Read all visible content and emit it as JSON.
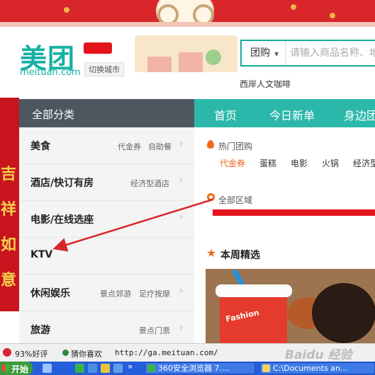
{
  "header": {
    "logo_cn": "美团",
    "logo_en": "meituan.com",
    "city_switch": "切换城市",
    "search_type": "团购",
    "search_placeholder": "请输入商品名称、地",
    "shop_name": "西岸人文咖啡"
  },
  "categories": {
    "title": "全部分类",
    "items": [
      {
        "label": "美食",
        "subs": [
          "代金券",
          "自助餐"
        ]
      },
      {
        "label": "酒店/快订有房",
        "subs": [
          "经济型酒店"
        ]
      },
      {
        "label": "电影/在线选座",
        "subs": []
      },
      {
        "label": "KTV",
        "subs": []
      },
      {
        "label": "休闲娱乐",
        "subs": [
          "景点郊游",
          "足疗按摩"
        ]
      },
      {
        "label": "旅游",
        "subs": [
          "景点门票"
        ]
      }
    ]
  },
  "nav": {
    "items": [
      "首页",
      "今日新单",
      "身边团"
    ]
  },
  "main": {
    "hot_title": "热门团购",
    "hot_tags": [
      "代金券",
      "蛋糕",
      "电影",
      "火锅",
      "经济型"
    ],
    "region_title": "全部区域",
    "weekly_title": "本周精选",
    "photo_brand": "Fashion"
  },
  "decor": {
    "left_chars": [
      "吉",
      "祥",
      "如",
      "意"
    ]
  },
  "status_bar": {
    "rating": "93%好评",
    "guess": "猜你喜欢",
    "url": "http://ga.meituan.com/",
    "watermark": "Baidu 经验"
  },
  "taskbar": {
    "start": "开始",
    "items": [
      "360安全浏览器 7....",
      "C:\\Documents an..."
    ]
  },
  "colors": {
    "brand_teal": "#16b0a2",
    "nav_teal": "#2bb8aa",
    "sidebar_header": "#4d5760",
    "accent_orange": "#ee6a1e",
    "redaction_red": "#e3141c"
  }
}
